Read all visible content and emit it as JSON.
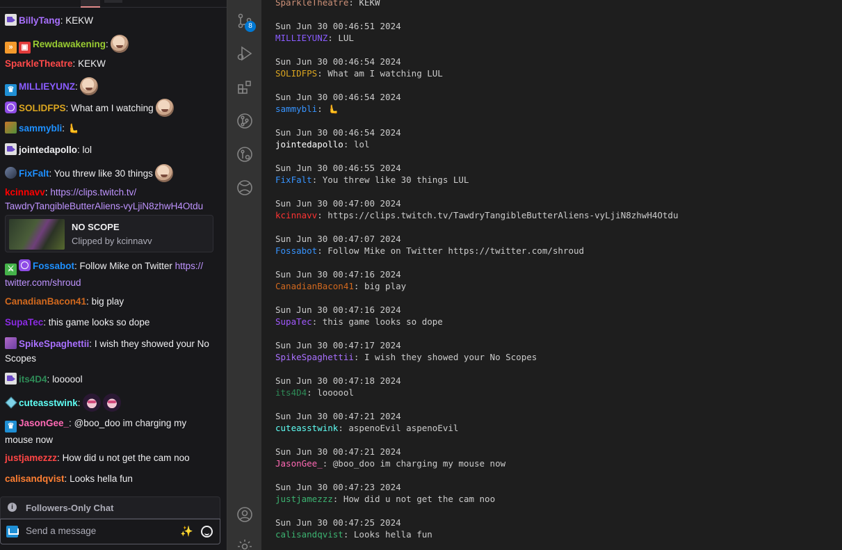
{
  "chat": {
    "messages": [
      {
        "user": "BillyTang",
        "color": "#a970ff",
        "badges": [
          "video"
        ],
        "text": "KEKW",
        "emotes": 0
      },
      {
        "user": "Rewdawakening",
        "color": "#9acd32",
        "badges": [
          "orange",
          "gift"
        ],
        "text": "",
        "emotes": 1
      },
      {
        "user": "SparkleTheatre",
        "color": "#ff4a4a",
        "badges": [],
        "text": "KEKW",
        "emotes": 0
      },
      {
        "user": "MILLIEYUNZ",
        "color": "#8a5cff",
        "badges": [
          "prime"
        ],
        "text": "",
        "emotes": 1
      },
      {
        "user": "SOLIDFPS",
        "color": "#daa520",
        "badges": [
          "verified"
        ],
        "text": "What am I watching",
        "emotes": 1
      },
      {
        "user": "sammybli",
        "color": "#1e90ff",
        "badges": [
          "avatar"
        ],
        "text": "🫷",
        "emotes": 0
      },
      {
        "user": "jointedapollo",
        "color": "#efeff1",
        "badges": [
          "video"
        ],
        "text": "lol",
        "emotes": 0
      },
      {
        "user": "FixFalt",
        "color": "#1e90ff",
        "badges": [
          "avatar2"
        ],
        "text": "You threw like 30 things",
        "emotes": 1
      },
      {
        "user": "kcinnavv",
        "color": "#ff0000",
        "badges": [],
        "text_link_1": "https://clips.twitch.tv/",
        "text_link_2": "TawdryTangibleButterAliens-vyLjiN8zhwH4Otdu"
      },
      {
        "user": "Fossabot",
        "color": "#1e90ff",
        "badges": [
          "green",
          "verified"
        ],
        "text": "Follow Mike on Twitter ",
        "link_1": "https://",
        "link_2": "twitter.com/shroud"
      },
      {
        "user": "CanadianBacon41",
        "color": "#d2691e",
        "badges": [],
        "text": "big play"
      },
      {
        "user": "SupaTec",
        "color": "#8a2be2",
        "badges": [],
        "text": "this game looks so dope"
      },
      {
        "user": "SpikeSpaghettii",
        "color": "#a970ff",
        "badges": [
          "sub"
        ],
        "text_1": "I wish they showed your No",
        "text_2": "Scopes"
      },
      {
        "user": "its4D4",
        "color": "#2e8b57",
        "badges": [
          "video"
        ],
        "text": "loooool"
      },
      {
        "user": "cuteasstwink",
        "color": "#5ffff5",
        "badges": [
          "gem"
        ],
        "text": "",
        "emotes": 2
      },
      {
        "user": "JasonGee_",
        "color": "#ff69b4",
        "badges": [
          "prime"
        ],
        "text_1": "@boo_doo im charging my",
        "text_2": "mouse now"
      },
      {
        "user": "justjamezzz",
        "color": "#ff4545",
        "badges": [],
        "text": "How did u not get the cam noo"
      },
      {
        "user": "calisandqvist",
        "color": "#ff7f32",
        "badges": [],
        "text": "Looks hella fun"
      }
    ],
    "clip": {
      "title": "NO SCOPE",
      "byline": "Clipped by kcinnavv"
    },
    "followers_only": "Followers-Only Chat",
    "input_placeholder": "Send a message",
    "separator": ":"
  },
  "activity_bar": {
    "items": [
      "source-control-icon",
      "run-debug-icon",
      "extensions-icon",
      "git-graph-icon",
      "remote-icon",
      "live-share-icon",
      "account-icon",
      "settings-gear-icon"
    ],
    "scm_badge": "8"
  },
  "log": {
    "top_partial": {
      "user": "SparkleTheatre",
      "color": "#ce9178",
      "text": ": KEKW"
    },
    "entries": [
      {
        "ts": "Sun Jun 30 00:46:51 2024",
        "user": "MILLIEYUNZ",
        "color": "#8a5cff",
        "text": ": LUL"
      },
      {
        "ts": "Sun Jun 30 00:46:54 2024",
        "user": "SOLIDFPS",
        "color": "#daa520",
        "text": ": What am I watching LUL"
      },
      {
        "ts": "Sun Jun 30 00:46:54 2024",
        "user": "sammybli",
        "color": "#3794ff",
        "text": ": 🫷"
      },
      {
        "ts": "Sun Jun 30 00:46:54 2024",
        "user": "jointedapollo",
        "color": "#ffffff",
        "text": ": lol"
      },
      {
        "ts": "Sun Jun 30 00:46:55 2024",
        "user": "FixFalt",
        "color": "#3794ff",
        "text": ": You threw like 30 things LUL"
      },
      {
        "ts": "Sun Jun 30 00:47:00 2024",
        "user": "kcinnavv",
        "color": "#ff3333",
        "text": ": https://clips.twitch.tv/TawdryTangibleButterAliens-vyLjiN8zhwH4Otdu"
      },
      {
        "ts": "Sun Jun 30 00:47:07 2024",
        "user": "Fossabot",
        "color": "#3794ff",
        "text": ": Follow Mike on Twitter https://twitter.com/shroud"
      },
      {
        "ts": "Sun Jun 30 00:47:16 2024",
        "user": "CanadianBacon41",
        "color": "#d2691e",
        "text": ": big play"
      },
      {
        "ts": "Sun Jun 30 00:47:16 2024",
        "user": "SupaTec",
        "color": "#a259ff",
        "text": ": this game looks so dope"
      },
      {
        "ts": "Sun Jun 30 00:47:17 2024",
        "user": "SpikeSpaghettii",
        "color": "#a970ff",
        "text": ": I wish they showed your No Scopes"
      },
      {
        "ts": "Sun Jun 30 00:47:18 2024",
        "user": "its4D4",
        "color": "#2e8b57",
        "text": ": loooool"
      },
      {
        "ts": "Sun Jun 30 00:47:21 2024",
        "user": "cuteasstwink",
        "color": "#5ffff5",
        "text": ": aspenoEvil aspenoEvil"
      },
      {
        "ts": "Sun Jun 30 00:47:21 2024",
        "user": "JasonGee_",
        "color": "#ff69b4",
        "text": ": @boo_doo im charging my mouse now"
      },
      {
        "ts": "Sun Jun 30 00:47:23 2024",
        "user": "justjamezzz",
        "color": "#3cb371",
        "text": ": How did u not get the cam noo"
      },
      {
        "ts": "Sun Jun 30 00:47:25 2024",
        "user": "calisandqvist",
        "color": "#3cb371",
        "text": ": Looks hella fun"
      }
    ]
  }
}
